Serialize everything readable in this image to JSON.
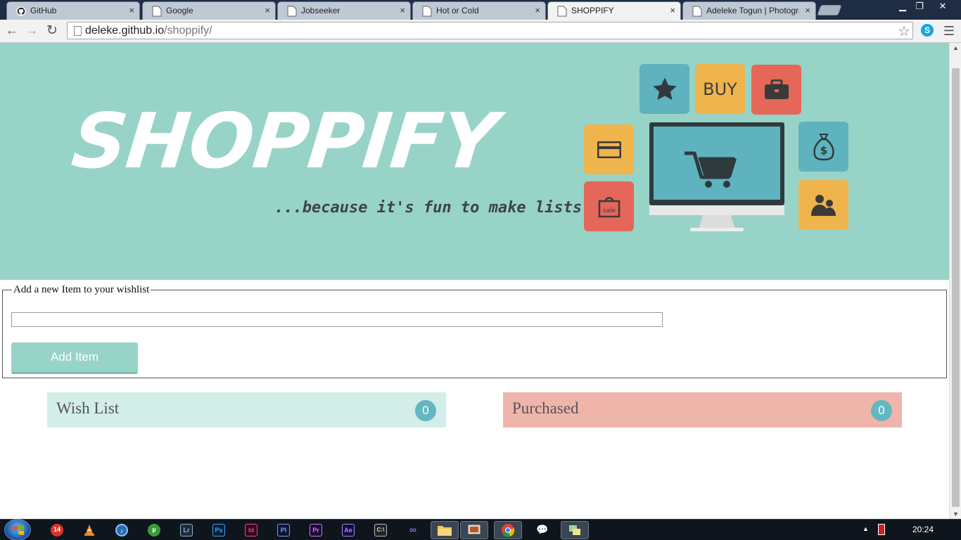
{
  "browser": {
    "tabs": [
      {
        "title": "GitHub",
        "icon": "github-icon",
        "active": false
      },
      {
        "title": "Google",
        "icon": "page-icon",
        "active": false
      },
      {
        "title": "Jobseeker",
        "icon": "page-icon",
        "active": false
      },
      {
        "title": "Hot or Cold",
        "icon": "page-icon",
        "active": false
      },
      {
        "title": "SHOPPIFY",
        "icon": "page-icon",
        "active": true
      },
      {
        "title": "Adeleke Togun | Photogra",
        "icon": "page-icon",
        "active": false
      }
    ],
    "close_glyph": "×",
    "url_host": "deleke.github.io",
    "url_path": "/shoppify/"
  },
  "hero": {
    "logo": "SHOPPIFY",
    "tagline": "...because it's fun to make lists",
    "buy_tile": "BUY",
    "sale_tag": "sale",
    "colors": {
      "background": "#98d3c7",
      "teal_tile": "#5fb3bf",
      "orange_tile": "#f0b44c",
      "red_tile": "#e4675a"
    }
  },
  "form": {
    "legend": "Add a new Item to your wishlist",
    "input_value": "",
    "add_button": "Add Item"
  },
  "lists": {
    "wish": {
      "title": "Wish List",
      "count": "0",
      "color": "#d3ede8"
    },
    "purchased": {
      "title": "Purchased",
      "count": "0",
      "color": "#efb5aa"
    }
  },
  "taskbar": {
    "time": "20:24",
    "app_badges": [
      "14",
      "Lr",
      "Ps",
      "Id",
      "Pl",
      "Pr",
      "Ae"
    ]
  }
}
